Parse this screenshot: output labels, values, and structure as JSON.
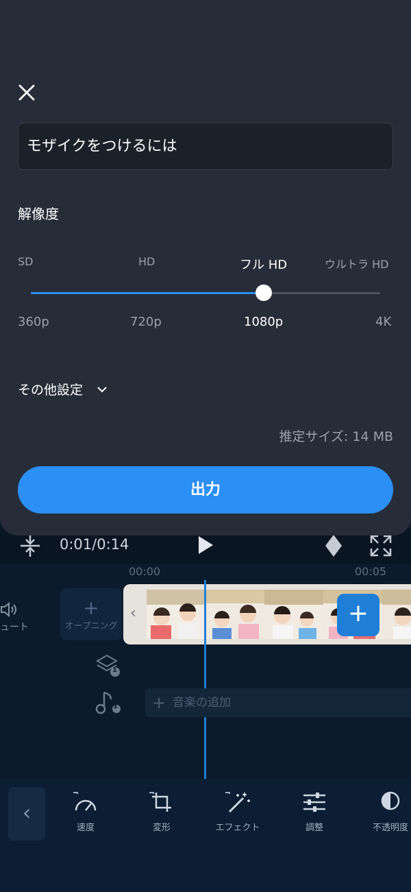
{
  "sheet": {
    "title_value": "モザイクをつけるには",
    "resolution_heading": "解像度",
    "quality_labels": [
      "SD",
      "HD",
      "フル HD",
      "ウルトラ HD"
    ],
    "resolution_labels": [
      "360p",
      "720p",
      "1080p",
      "4K"
    ],
    "selected_index": 2,
    "more_settings_label": "その他設定",
    "estimate_text": "推定サイズ: 14 MB",
    "export_label": "出力"
  },
  "player": {
    "time": "0:01/0:14"
  },
  "timeline": {
    "ruler": [
      "00:00",
      "00:05"
    ],
    "mute_label": "ュート",
    "opening_label": "オープニング",
    "layer_badge": "1",
    "music_badge": "1",
    "music_placeholder": "音楽の追加"
  },
  "toolbar": {
    "items": [
      {
        "label": "速度",
        "icon": "speedometer-icon"
      },
      {
        "label": "変形",
        "icon": "crop-icon"
      },
      {
        "label": "エフェクト",
        "icon": "magic-wand-icon"
      },
      {
        "label": "調整",
        "icon": "sliders-icon"
      },
      {
        "label": "不透明度",
        "icon": "opacity-icon"
      }
    ]
  },
  "colors": {
    "accent": "#2b8ff5",
    "sheet_bg": "#272d38",
    "editor_bg": "#0d1c2d"
  }
}
